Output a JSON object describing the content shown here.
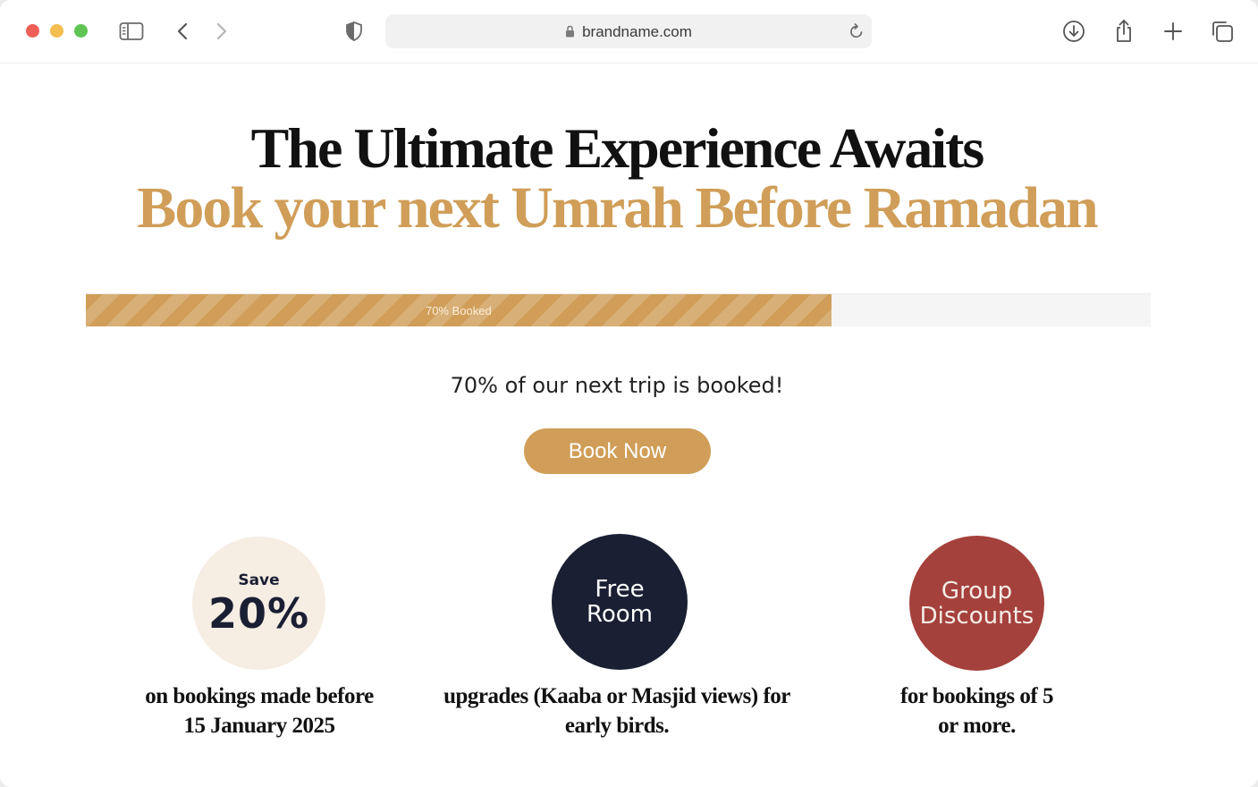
{
  "browser": {
    "url": "brandname.com",
    "icons": [
      "sidebar-icon",
      "back-icon",
      "forward-icon",
      "shield-icon",
      "lock-icon",
      "reload-icon",
      "download-icon",
      "share-icon",
      "new-tab-icon",
      "tabs-overview-icon"
    ]
  },
  "hero": {
    "title": "The Ultimate Experience Awaits",
    "subtitle": "Book your next Umrah Before Ramadan"
  },
  "progress": {
    "value": 0.7,
    "label": "70% Booked",
    "caption": "70% of our next trip is booked!"
  },
  "cta": {
    "label": "Book Now"
  },
  "features": [
    {
      "top": "Save",
      "value": "20%",
      "caption_line1": "on bookings made before",
      "caption_line2": "15 January 2025"
    },
    {
      "line1": "Free",
      "line2": "Room",
      "caption_line1": "upgrades (Kaaba or Masjid views) for",
      "caption_line2": "early birds."
    },
    {
      "line1": "Group",
      "line2": "Discounts",
      "caption_line1": "for bookings of 5",
      "caption_line2": "or more."
    }
  ],
  "colors": {
    "gold": "#d09e58",
    "navy": "#1a1f33",
    "red": "#a5413c",
    "cream": "#f6ede3"
  }
}
